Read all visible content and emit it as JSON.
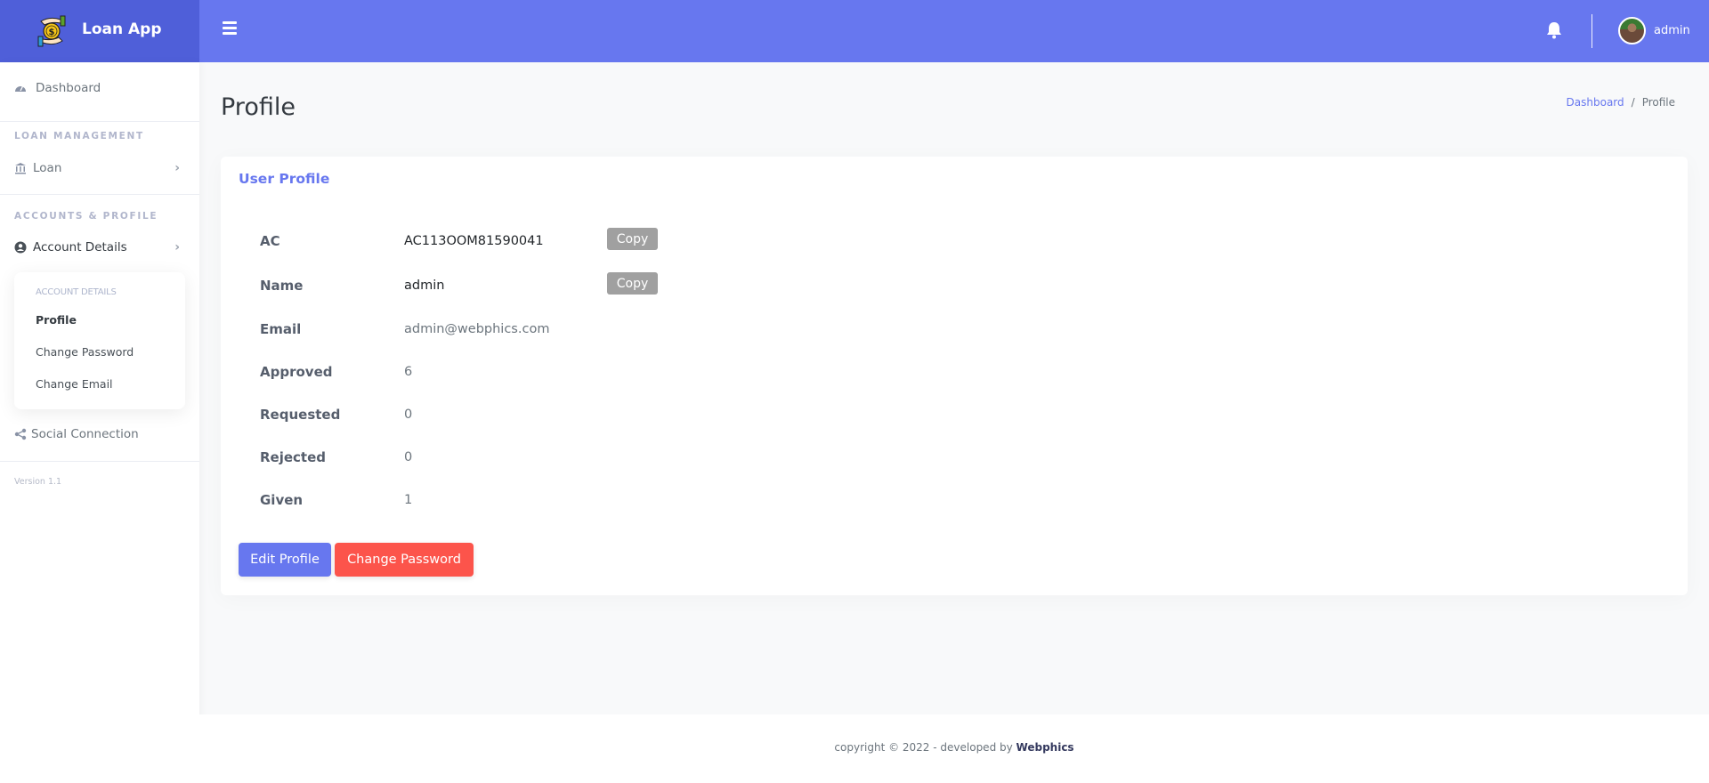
{
  "app": {
    "name": "Loan App"
  },
  "topbar": {
    "user_name": "admin"
  },
  "sidebar": {
    "dashboard": "Dashboard",
    "section_loan": "LOAN MANAGEMENT",
    "loan": "Loan",
    "section_accounts": "ACCOUNTS & PROFILE",
    "account_details": "Account Details",
    "submenu": {
      "header": "ACCOUNT DETAILS",
      "items": [
        "Profile",
        "Change Password",
        "Change Email"
      ],
      "active": "Profile"
    },
    "social": "Social Connection",
    "version": "Version 1.1"
  },
  "page": {
    "title": "Profile",
    "breadcrumb": {
      "home": "Dashboard",
      "separator": "/",
      "current": "Profile"
    }
  },
  "card": {
    "title": "User Profile",
    "copy_label": "Copy",
    "fields": [
      {
        "label": "AC",
        "value": "AC113OOM81590041"
      },
      {
        "label": "Name",
        "value": "admin"
      },
      {
        "label": "Email",
        "value": "admin@webphics.com"
      },
      {
        "label": "Approved",
        "value": "6"
      },
      {
        "label": "Requested",
        "value": "0"
      },
      {
        "label": "Rejected",
        "value": "0"
      },
      {
        "label": "Given",
        "value": "1"
      }
    ],
    "edit_button": "Edit Profile",
    "password_button": "Change Password"
  },
  "footer": {
    "text": "copyright © 2022 - developed by ",
    "brand": "Webphics"
  },
  "colors": {
    "primary": "#6777ef",
    "brand_dark": "#4f5fd9",
    "danger": "#fc544b",
    "copy_gray": "#a0a0a0"
  }
}
